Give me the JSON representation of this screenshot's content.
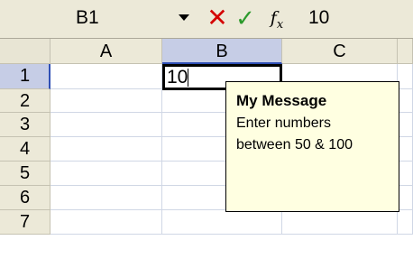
{
  "formula_bar": {
    "name_box": "B1",
    "formula_value": "10",
    "fx_label": "fx"
  },
  "grid": {
    "columns": [
      "A",
      "B",
      "C"
    ],
    "rows": [
      "1",
      "2",
      "3",
      "4",
      "5",
      "6",
      "7"
    ],
    "active_column": "B",
    "active_row": "1",
    "active_cell_value": "10"
  },
  "input_message": {
    "title": "My Message",
    "body": "Enter numbers\nbetween 50 & 100"
  },
  "colors": {
    "header_bg": "#ece9d8",
    "active_header_bg": "#c6cde6",
    "tooltip_bg": "#ffffe1",
    "cancel": "#d40000",
    "enter": "#2c9a2c"
  }
}
